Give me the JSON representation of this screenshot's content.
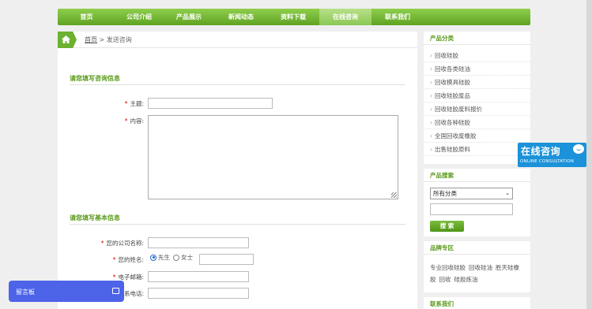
{
  "nav": {
    "items": [
      {
        "label": "首页",
        "width": 73
      },
      {
        "label": "公司介绍",
        "width": 60
      },
      {
        "label": "产品展示",
        "width": 66
      },
      {
        "label": "新闻动态",
        "width": 66
      },
      {
        "label": "资料下载",
        "width": 66
      },
      {
        "label": "在线咨询",
        "width": 66,
        "active": true
      },
      {
        "label": "联系我们",
        "width": 66
      }
    ]
  },
  "breadcrumb": {
    "home": "首页",
    "sep": " > ",
    "current": "发送咨询"
  },
  "form": {
    "section1_title": "请您填写咨询信息",
    "subject_label": "主题:",
    "content_label": "内容:",
    "section2_title": "请您填写基本信息",
    "company_label": "您的公司名称:",
    "name_label": "您的姓名:",
    "gender_male": "先生",
    "gender_female": "女士",
    "email_label": "电子邮箱:",
    "phone_label": "联系电话:",
    "required_mark": "*"
  },
  "sidebar": {
    "categories_title": "产品分类",
    "categories": [
      "回收硅胶",
      "回收各类硅油",
      "回收模具硅胶",
      "回收硅胶废品",
      "回收硅胶废料报价",
      "回收各种硅胶",
      "全国回收废橡胶",
      "出售硅胶原料"
    ],
    "search_title": "产品搜索",
    "search_select": "所有分类",
    "search_button": "搜 索",
    "brand_title": "品牌专区",
    "brand_tags": [
      "专业回收硅胶",
      "回收硅油",
      "胜天硅橡胶",
      "回收",
      "硅胶炼油"
    ],
    "contact_title": "联系我们"
  },
  "consult": {
    "cn": "在线咨询",
    "en": "ONLINE CONSULTATION"
  },
  "message_board": {
    "label": "留言板"
  }
}
